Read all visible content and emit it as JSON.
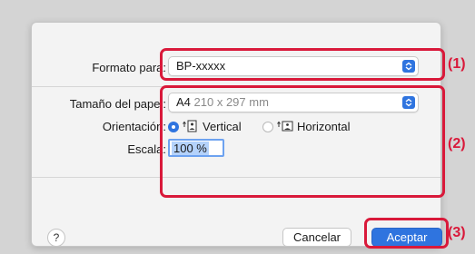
{
  "printer": {
    "label": "Formato para:",
    "value": "BP-xxxxx"
  },
  "paper_size": {
    "label": "Tamaño del papel:",
    "value": "A4",
    "detail": "210 x 297 mm"
  },
  "orientation": {
    "label": "Orientación:",
    "options": [
      {
        "label": "Vertical",
        "selected": true
      },
      {
        "label": "Horizontal",
        "selected": false
      }
    ]
  },
  "scale": {
    "label": "Escala:",
    "value": "100 %"
  },
  "footer": {
    "help_label": "?",
    "cancel_label": "Cancelar",
    "accept_label": "Aceptar"
  },
  "callouts": [
    "(1)",
    "(2)",
    "(3)"
  ],
  "colors": {
    "accent": "#2f74df",
    "highlight": "#d9193a",
    "dialog_bg": "#f3f3f3"
  },
  "icons": {
    "popup_arrows": "updown-chevron-icon",
    "portrait": "portrait-orientation-icon",
    "landscape": "landscape-orientation-icon"
  }
}
